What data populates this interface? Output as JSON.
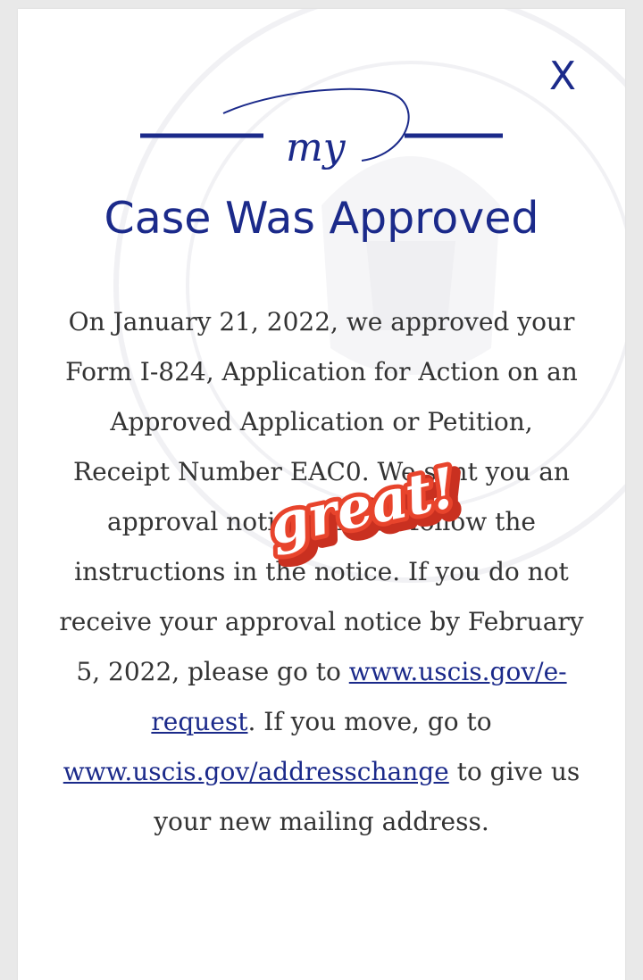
{
  "modal": {
    "close_label": "X",
    "logo_text": "my",
    "title": "Case Was Approved",
    "message": {
      "part1": "On January 21, 2022, we approved your Form I-824, Application for Action on an Approved Application or Petition, Receipt Number EAC",
      "part2": "0. We sent you an approval notice. Please follow the instructions in the notice. If you do not receive your approval notice by February 5, 2022, please go to ",
      "link1": "www.uscis.gov/e-request",
      "part3": ". If you move, go to ",
      "link2": "www.uscis.gov/addresschange",
      "part4": " to give us your new mailing address."
    }
  },
  "sticker": {
    "text": "great!"
  },
  "colors": {
    "brand_blue": "#1b2a8a",
    "sticker_red": "#e8442c"
  }
}
